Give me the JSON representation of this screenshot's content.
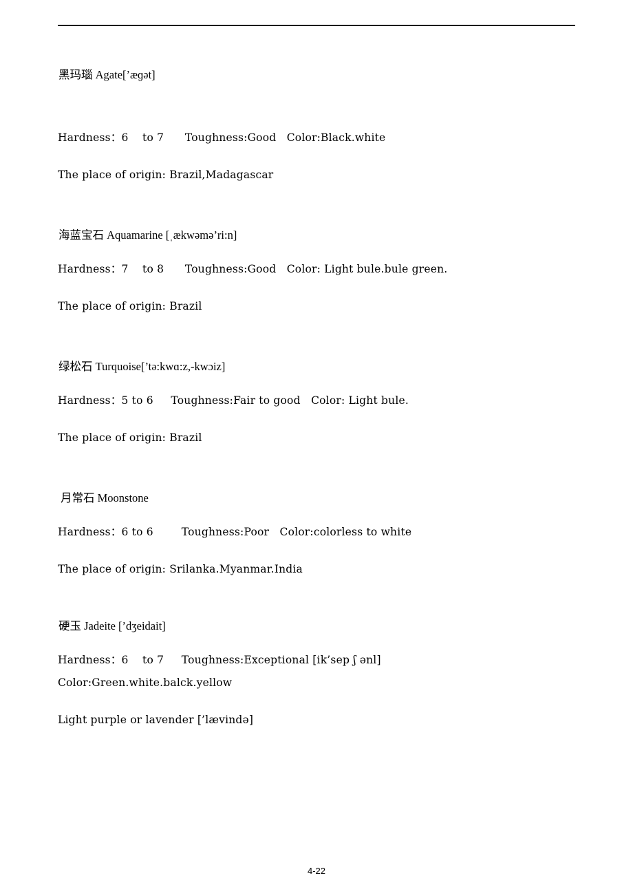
{
  "document": {
    "header_rule": true,
    "footer_page_label": "4-22",
    "labels": {
      "hardness": "Hardness",
      "toughness": "Toughness",
      "color": "Color",
      "origin": "The place of origin"
    },
    "gems": [
      {
        "name_cn": "黑玛瑙",
        "name_en": "Agate",
        "phonetic": "[’æɡət]",
        "heading": "黑玛瑙 Agate[’æɡət]",
        "hardness_line": "Hardness：6    to 7      Toughness:Good   Color:Black.white",
        "hardness": "6 to 7",
        "toughness": "Good",
        "color": "Black.white",
        "origin_line": "The place of origin: Brazil,Madagascar",
        "origin": "Brazil,Madagascar",
        "extra_lines": []
      },
      {
        "name_cn": "海蓝宝石",
        "name_en": "Aquamarine",
        "phonetic": "[ˌækwəmə’ri:n]",
        "heading": "海蓝宝石 Aquamarine [ˌækwəmə’ri:n]",
        "hardness_line": "Hardness：7    to 8      Toughness:Good   Color: Light bule.bule green.",
        "hardness": "7 to 8",
        "toughness": "Good",
        "color": "Light bule.bule green.",
        "origin_line": "The place of origin: Brazil",
        "origin": "Brazil",
        "extra_lines": []
      },
      {
        "name_cn": "绿松石",
        "name_en": "Turquoise",
        "phonetic": "[’tə:kwɑ:z,-kwɔiz]",
        "heading": "绿松石 Turquoise[’tə:kwɑ:z,-kwɔiz]",
        "hardness_line": "Hardness：5 to 6     Toughness:Fair to good   Color: Light bule.",
        "hardness": "5 to 6",
        "toughness": "Fair to good",
        "color": "Light bule.",
        "origin_line": "The place of origin: Brazil",
        "origin": "Brazil",
        "extra_lines": []
      },
      {
        "name_cn": "月常石",
        "name_en": "Moonstone",
        "phonetic": "",
        "heading": "月常石 Moonstone",
        "hardness_line": "Hardness：6 to 6        Toughness:Poor   Color:colorless to white",
        "hardness": "6 to 6",
        "toughness": "Poor",
        "color": "colorless to white",
        "origin_line": "The place of origin: Srilanka.Myanmar.India",
        "origin": "Srilanka.Myanmar.India",
        "extra_lines": []
      },
      {
        "name_cn": "硬玉",
        "name_en": "Jadeite",
        "phonetic": "[’dʒeidait]",
        "heading": "硬玉 Jadeite [’dʒeidait]",
        "hardness_line": "Hardness：6    to 7     Toughness:Exceptional [ik’sep ʃ ənl]",
        "hardness": "6 to 7",
        "toughness": "Exceptional [ik’sep ʃ ənl]",
        "color": "Green.white.balck.yellow",
        "color_line": "Color:Green.white.balck.yellow",
        "origin_line": "",
        "origin": "",
        "extra_lines": [
          "Light purple or lavender [’lævində]"
        ]
      }
    ]
  }
}
